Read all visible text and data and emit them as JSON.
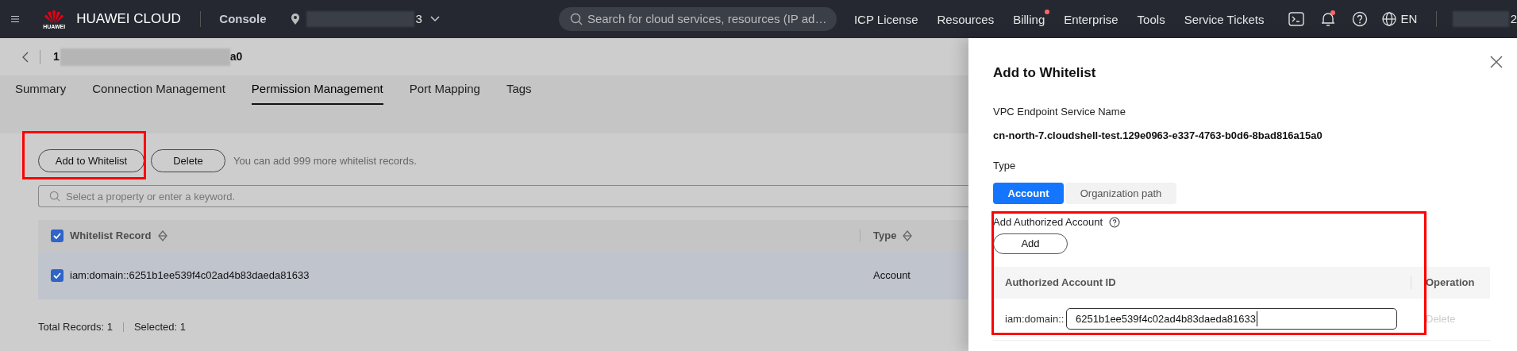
{
  "top_bar": {
    "logo_text": "HUAWEI",
    "brand": "HUAWEI CLOUD",
    "console": "Console",
    "region_suffix": "3",
    "search": {
      "placeholder": "Search for cloud services, resources (IP ad…"
    },
    "nav": [
      {
        "label": "ICP License",
        "dot": false
      },
      {
        "label": "Resources",
        "dot": false
      },
      {
        "label": "Billing",
        "dot": true
      },
      {
        "label": "Enterprise",
        "dot": false
      },
      {
        "label": "Tools",
        "dot": false
      },
      {
        "label": "Service Tickets",
        "dot": false
      }
    ],
    "icons": [
      {
        "kind": "terminal",
        "dot": false
      },
      {
        "kind": "bell",
        "dot": true
      },
      {
        "kind": "help",
        "dot": false
      }
    ],
    "language": "EN",
    "account_suffix": "2"
  },
  "page": {
    "resource_id": {
      "prefix": "1",
      "suffix": "a0"
    },
    "tabs": [
      {
        "label": "Summary",
        "selected": false
      },
      {
        "label": "Connection Management",
        "selected": false
      },
      {
        "label": "Permission Management",
        "selected": true
      },
      {
        "label": "Port Mapping",
        "selected": false
      },
      {
        "label": "Tags",
        "selected": false
      }
    ],
    "buttons": [
      "Add to Whitelist",
      "Delete"
    ],
    "hint": "You can add 999 more whitelist records.",
    "filter": {
      "placeholder": "Select a property or enter a keyword."
    },
    "table": {
      "all_checked": true,
      "columns": [
        {
          "label": "Whitelist Record",
          "sortable": true
        },
        {
          "label": "Type",
          "sortable": true
        }
      ],
      "rows": [
        {
          "checked": true,
          "selected": true,
          "cells": [
            "iam:domain::6251b1ee539f4c02ad4b83daeda81633",
            "Account"
          ]
        }
      ]
    },
    "footer": [
      "Total Records: 1",
      "Selected: 1"
    ]
  },
  "drawer": {
    "title": "Add to Whitelist",
    "service_label": "VPC Endpoint Service Name",
    "service_name": "cn-north-7.cloudshell-test.129e0963-e337-4763-b0d6-8bad816a15a0",
    "type_label": "Type",
    "type_options": [
      {
        "label": "Account",
        "selected": true
      },
      {
        "label": "Organization path",
        "selected": false
      }
    ],
    "accounts_label": "Add Authorized Account",
    "add_button": "Add",
    "columns": [
      "Authorized Account ID",
      "Operation"
    ],
    "rows": [
      {
        "prefix": "iam:domain::",
        "value": "6251b1ee539f4c02ad4b83daeda81633",
        "action": "Delete",
        "action_disabled": true
      }
    ]
  }
}
